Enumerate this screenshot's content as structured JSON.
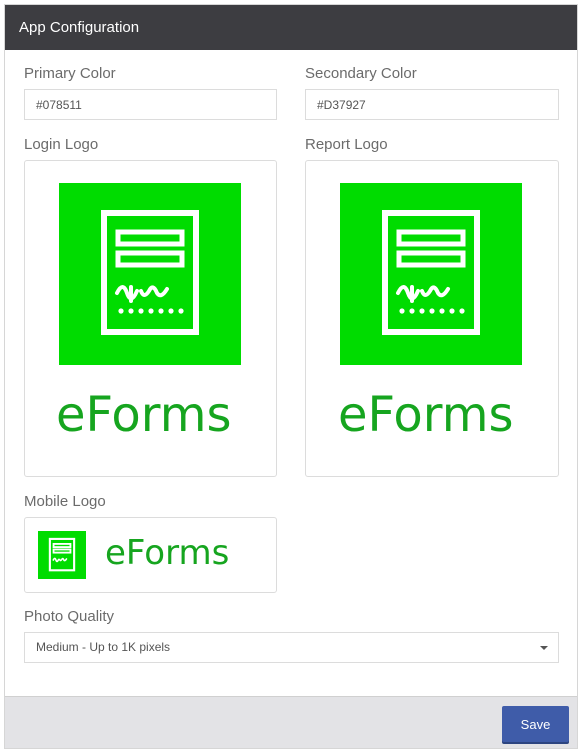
{
  "header": {
    "title": "App Configuration"
  },
  "primary_color": {
    "label": "Primary Color",
    "value": "#078511"
  },
  "secondary_color": {
    "label": "Secondary Color",
    "value": "#D37927"
  },
  "login_logo": {
    "label": "Login Logo",
    "brand": "eForms"
  },
  "report_logo": {
    "label": "Report Logo",
    "brand": "eForms"
  },
  "mobile_logo": {
    "label": "Mobile Logo",
    "brand": "eForms"
  },
  "photo_quality": {
    "label": "Photo Quality",
    "selected": "Medium - Up to 1K pixels"
  },
  "footer": {
    "save_label": "Save"
  },
  "colors": {
    "brand_green": "#00dc00",
    "brand_text": "#16a51f",
    "header_bg": "#3d3d41",
    "save_button": "#3f5ca9"
  }
}
